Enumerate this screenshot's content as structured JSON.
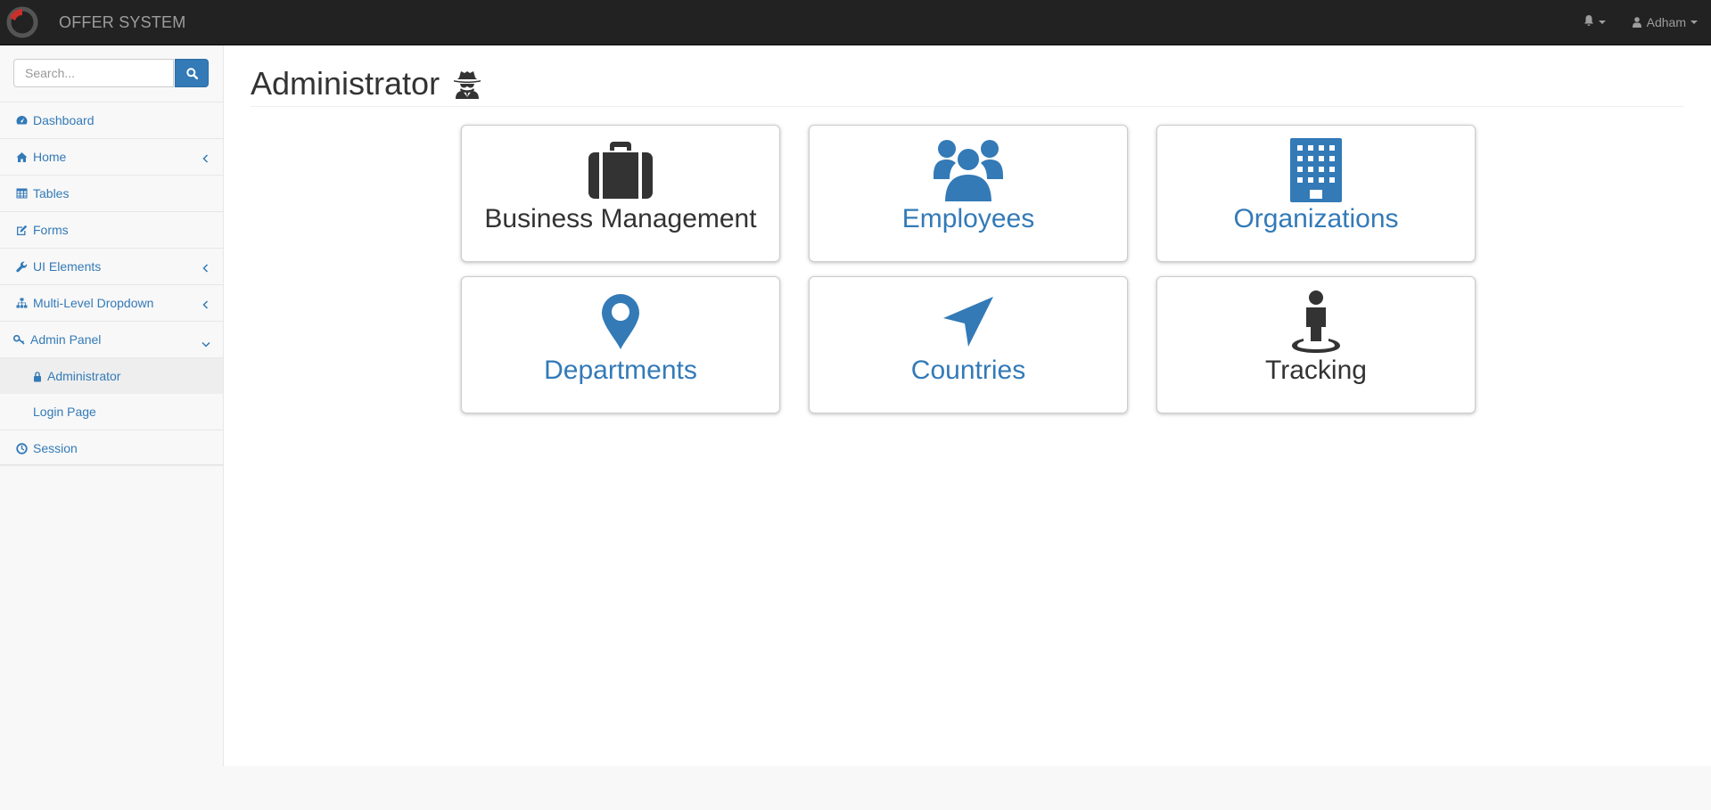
{
  "app": {
    "brand": "OFFER SYSTEM"
  },
  "navbar": {
    "notifications_icon": "bell-icon",
    "user_name": "Adham",
    "user_icon": "user-icon"
  },
  "search": {
    "placeholder": "Search...",
    "icon": "search-icon"
  },
  "sidebar": {
    "items": [
      {
        "label": "Dashboard",
        "icon": "dashboard-icon"
      },
      {
        "label": "Home",
        "icon": "home-icon",
        "has_arrow": true
      },
      {
        "label": "Tables",
        "icon": "table-icon"
      },
      {
        "label": "Forms",
        "icon": "edit-icon"
      },
      {
        "label": "UI Elements",
        "icon": "wrench-icon",
        "has_arrow": true
      },
      {
        "label": "Multi-Level Dropdown",
        "icon": "sitemap-icon",
        "has_arrow": true
      },
      {
        "label": "Admin Panel",
        "icon": "key-icon",
        "expanded": true
      },
      {
        "label": "Session",
        "icon": "clock-icon"
      }
    ],
    "admin_sub": [
      {
        "label": "Administrator",
        "icon": "lock-icon",
        "active": true
      },
      {
        "label": "Login Page"
      }
    ]
  },
  "page": {
    "title": "Administrator",
    "title_icon": "user-secret-icon"
  },
  "tiles": [
    {
      "label": "Business Management",
      "icon": "briefcase-icon",
      "color": "#333333"
    },
    {
      "label": "Employees",
      "icon": "users-icon",
      "color": "#337ab7"
    },
    {
      "label": "Organizations",
      "icon": "building-icon",
      "color": "#337ab7"
    },
    {
      "label": "Departments",
      "icon": "map-marker-icon",
      "color": "#337ab7"
    },
    {
      "label": "Countries",
      "icon": "location-arrow-icon",
      "color": "#337ab7"
    },
    {
      "label": "Tracking",
      "icon": "street-view-icon",
      "color": "#333333"
    }
  ],
  "colors": {
    "link": "#337ab7",
    "navbar": "#222222",
    "brand_accent": "#c9302c"
  }
}
